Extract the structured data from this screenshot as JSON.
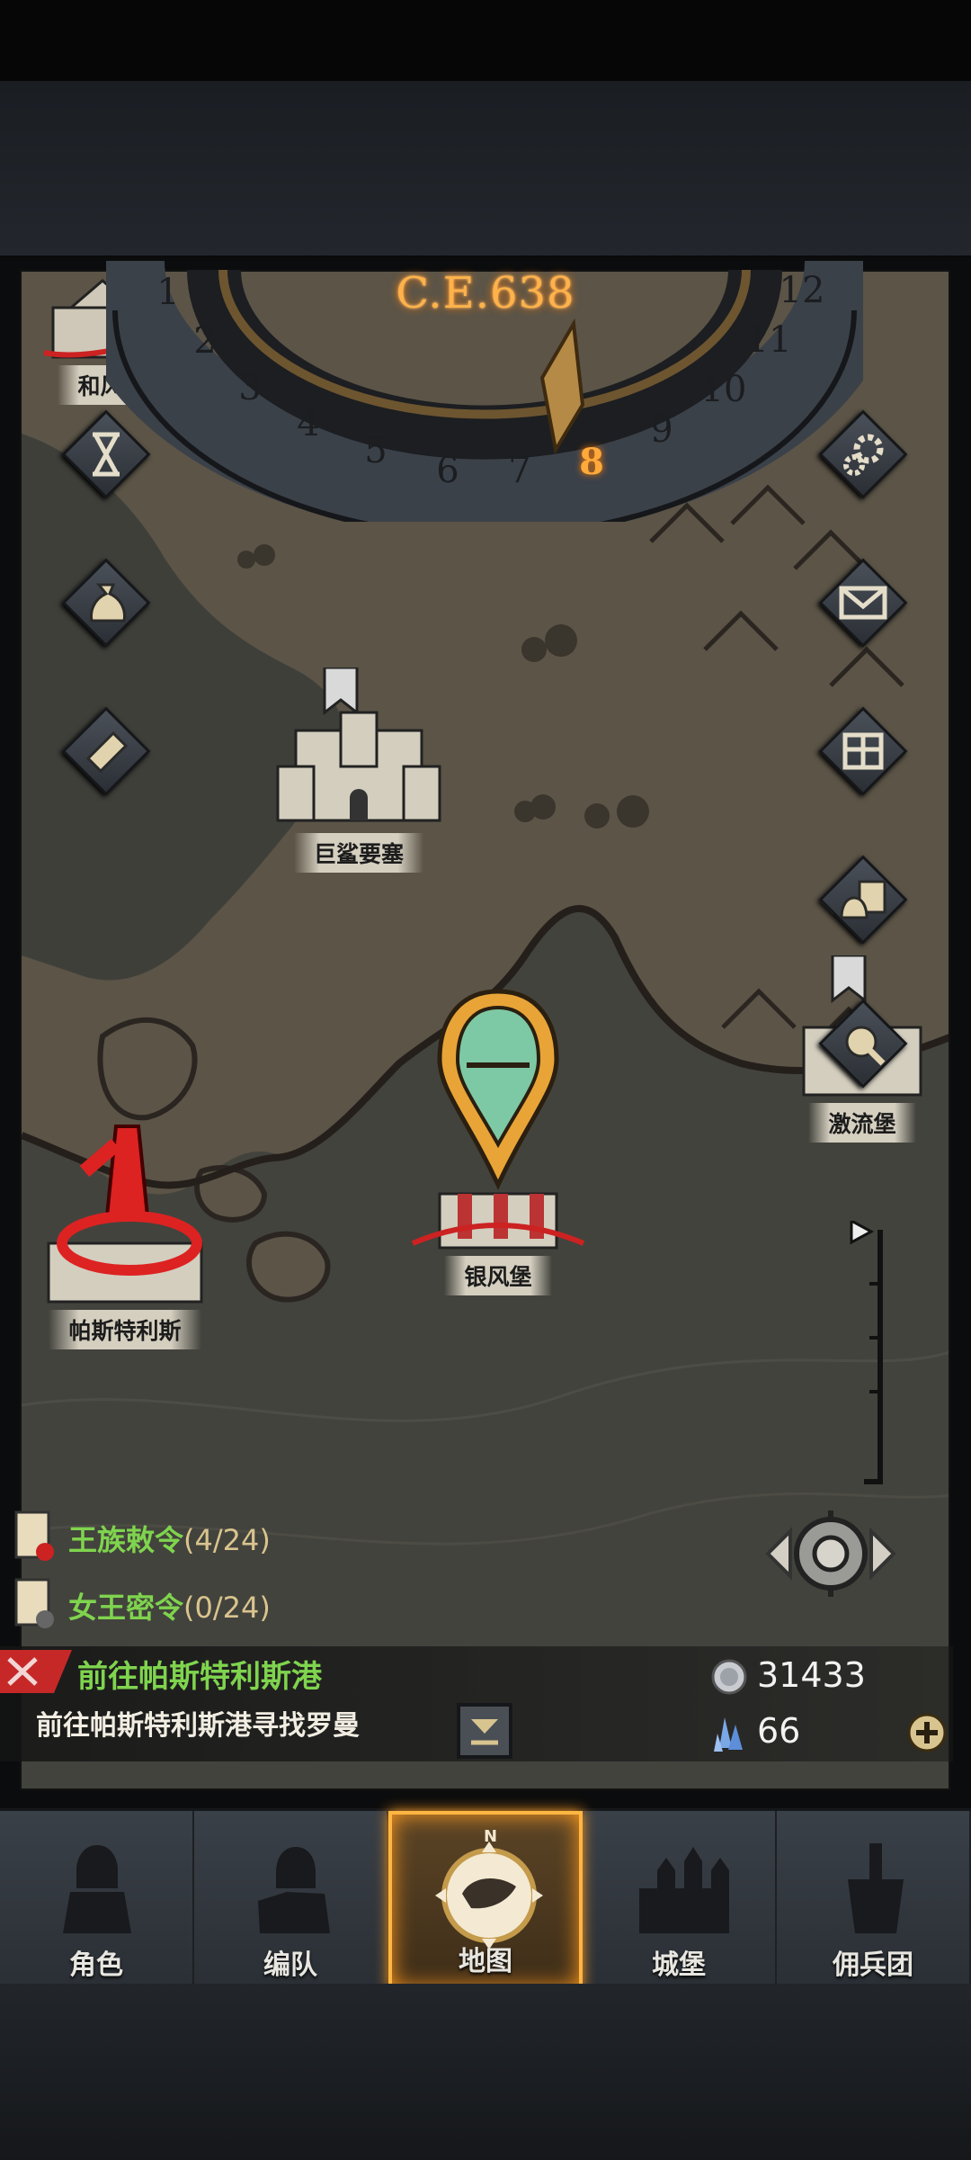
{
  "calendar": {
    "era": "C.E.638",
    "months": [
      "1",
      "2",
      "3",
      "4",
      "5",
      "6",
      "7",
      "8",
      "9",
      "10",
      "11",
      "12"
    ],
    "current_month": "8"
  },
  "side_buttons": {
    "left": [
      "hourglass-icon",
      "money-bag-icon",
      "scroll-icon"
    ],
    "right": [
      "gear-icon",
      "mail-icon",
      "grid-icon",
      "supplies-icon"
    ]
  },
  "towns": {
    "hefeng": "和风港",
    "jusha": "巨鲨要塞",
    "jiliu": "激流堡",
    "yinfeng": "银风堡",
    "pasi": "帕斯特利斯"
  },
  "quests": [
    {
      "title": "王族敕令",
      "count": "(4/24)"
    },
    {
      "title": "女王密令",
      "count": "(0/24)"
    }
  ],
  "goal": {
    "title": "前往帕斯特利斯港",
    "desc": "前往帕斯特利斯港寻找罗曼"
  },
  "resources": {
    "silver": "31433",
    "crystal": "66"
  },
  "nav": [
    {
      "label": "角色",
      "icon": "knight-icon"
    },
    {
      "label": "编队",
      "icon": "party-icon"
    },
    {
      "label": "地图",
      "icon": "compass-map-icon"
    },
    {
      "label": "城堡",
      "icon": "castle-icon"
    },
    {
      "label": "佣兵团",
      "icon": "mercenary-icon"
    }
  ],
  "colors": {
    "accent_orange": "#ffb24a",
    "quest_green": "#7fd44e",
    "map_land": "#5a5449",
    "map_water": "#44443f"
  }
}
